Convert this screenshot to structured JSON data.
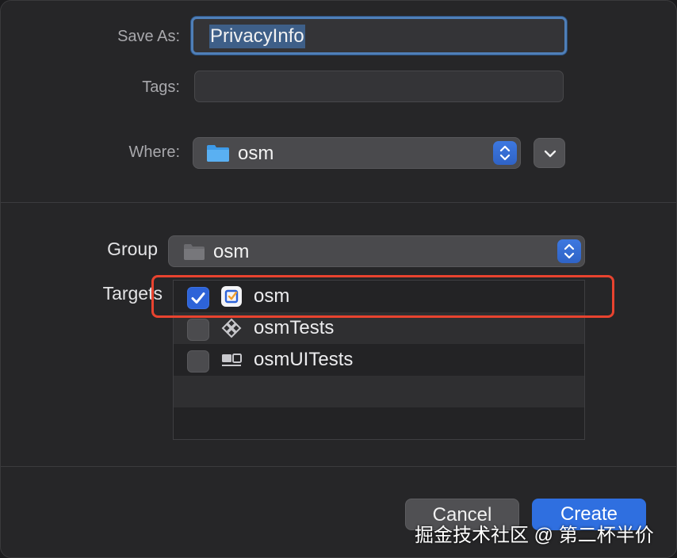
{
  "save_as": {
    "label": "Save As:",
    "value": "PrivacyInfo"
  },
  "tags": {
    "label": "Tags:",
    "value": ""
  },
  "where": {
    "label": "Where:",
    "value": "osm"
  },
  "group": {
    "label": "Group",
    "value": "osm"
  },
  "targets": {
    "label": "Targets",
    "items": [
      {
        "label": "osm",
        "checked": true,
        "icon": "app-target-icon"
      },
      {
        "label": "osmTests",
        "checked": false,
        "icon": "unit-test-bundle-icon"
      },
      {
        "label": "osmUITests",
        "checked": false,
        "icon": "ui-test-bundle-icon"
      }
    ]
  },
  "buttons": {
    "cancel": "Cancel",
    "create": "Create"
  },
  "watermark": "掘金技术社区 @ 第二杯半价",
  "colors": {
    "accent": "#2f6fe0",
    "highlight": "#e8432f",
    "background": "#262628"
  }
}
